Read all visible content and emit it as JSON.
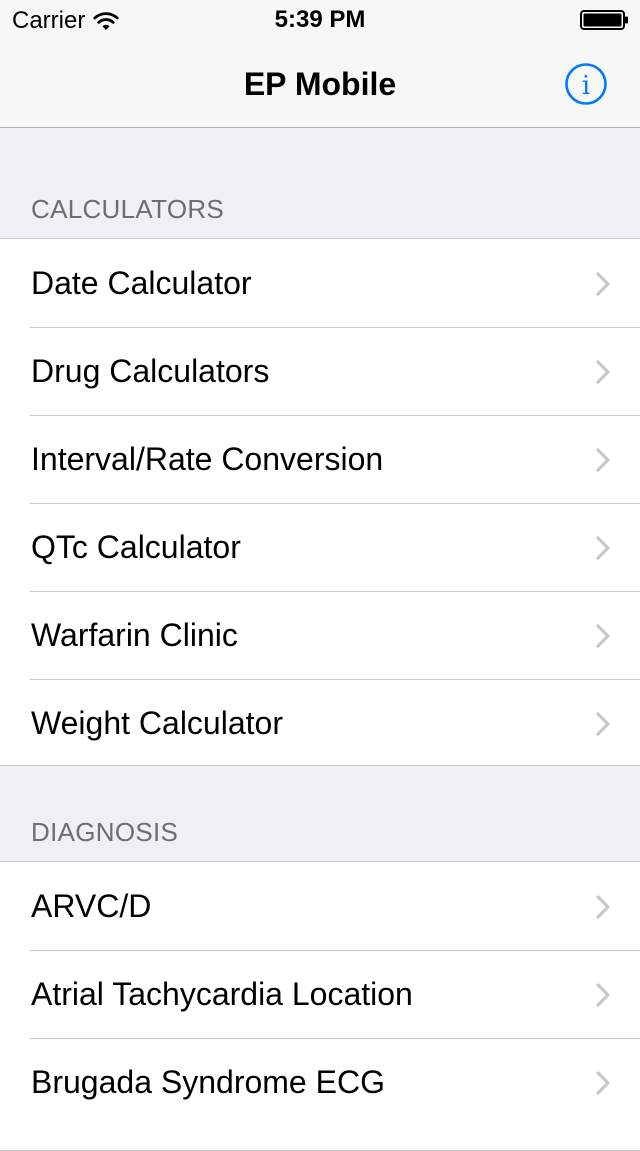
{
  "status_bar": {
    "carrier": "Carrier",
    "time": "5:39 PM",
    "wifi_icon": "wifi-icon",
    "battery_icon": "battery-full-icon"
  },
  "nav": {
    "title": "EP Mobile",
    "info_icon": "info-icon",
    "tint_color": "#007aff"
  },
  "sections": [
    {
      "header": "CALCULATORS",
      "items": [
        {
          "label": "Date Calculator"
        },
        {
          "label": "Drug Calculators"
        },
        {
          "label": "Interval/Rate Conversion"
        },
        {
          "label": "QTc Calculator"
        },
        {
          "label": "Warfarin Clinic"
        },
        {
          "label": "Weight Calculator"
        }
      ]
    },
    {
      "header": "DIAGNOSIS",
      "items": [
        {
          "label": "ARVC/D"
        },
        {
          "label": "Atrial Tachycardia Location"
        },
        {
          "label": "Brugada Syndrome ECG"
        }
      ]
    }
  ],
  "colors": {
    "background": "#efeff4",
    "separator": "#c8c7cc",
    "section_header_text": "#6d6d72",
    "chevron": "#c7c7cc"
  }
}
